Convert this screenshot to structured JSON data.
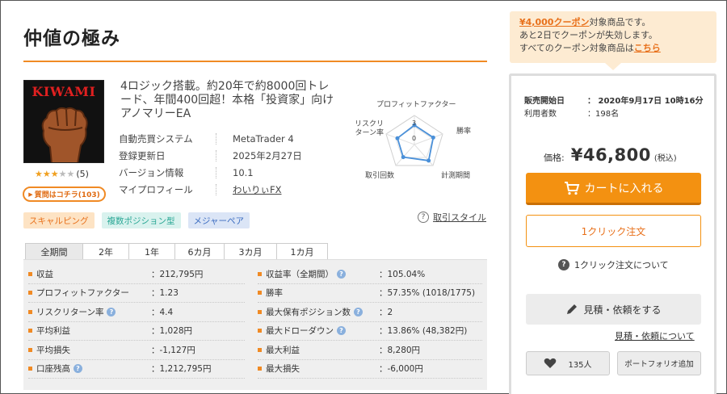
{
  "page": {
    "title": "仲値の極み"
  },
  "product": {
    "logo_text": "KIWAMI",
    "description": "4ロジック搭載。約20年で約8000回トレード、年間400回超！本格「投資家」向けアノマリーEA",
    "rating": 3,
    "rating_max": 5,
    "review_count": "(5)",
    "question_button": "質問はコチラ(103)",
    "info": [
      {
        "label": "自動売買システム",
        "value": "MetaTrader 4"
      },
      {
        "label": "登録更新日",
        "value": "2025年2月27日"
      },
      {
        "label": "バージョン情報",
        "value": "10.1"
      },
      {
        "label": "マイプロフィール",
        "value": "わいりぃFX"
      }
    ],
    "tags": [
      "スキャルピング",
      "複数ポジション型",
      "メジャーペア"
    ],
    "trade_style_link": "取引スタイル"
  },
  "radar": {
    "labels": {
      "profit_factor": "プロフィットファクター",
      "win_rate": "勝率",
      "period": "計測期間",
      "trades": "取引回数",
      "risk_return": "リスクリターン率"
    },
    "scale_max": "3",
    "scale_zero": "0",
    "values": [
      2,
      2,
      2.3,
      1.8,
      1.8
    ]
  },
  "period_tabs": [
    "全期間",
    "2年",
    "1年",
    "6カ月",
    "3カ月",
    "1カ月"
  ],
  "active_tab": "全期間",
  "stats_left": [
    {
      "label": "収益",
      "value": "：212,795円",
      "info": false
    },
    {
      "label": "プロフィットファクター",
      "value": "：1.23",
      "info": false
    },
    {
      "label": "リスクリターン率",
      "value": "：4.4",
      "info": true
    },
    {
      "label": "平均利益",
      "value": "：1,028円",
      "info": false
    },
    {
      "label": "平均損失",
      "value": "：-1,127円",
      "info": false
    },
    {
      "label": "口座残高",
      "value": "：1,212,795円",
      "info": true
    }
  ],
  "stats_right": [
    {
      "label": "収益率（全期間）",
      "value": "：105.04%",
      "info": true
    },
    {
      "label": "勝率",
      "value": "：57.35% (1018/1775)",
      "info": false
    },
    {
      "label": "最大保有ポジション数",
      "value": "：2",
      "info": true
    },
    {
      "label": "最大ドローダウン",
      "value": "：13.86% (48,382円)",
      "info": true
    },
    {
      "label": "最大利益",
      "value": "：8,280円",
      "info": false
    },
    {
      "label": "最大損失",
      "value": "：-6,000円",
      "info": false
    }
  ],
  "coupon": {
    "highlight": "¥4,000クーポン",
    "line1_rest": "対象商品です。",
    "line2": "あと2日でクーポンが失効します。",
    "line3_prefix": "すべてのクーポン対象商品は",
    "line3_link": "こちら"
  },
  "buybox": {
    "sale_start_label": "販売開始日",
    "sale_start_value": "：  2020年9月17日 10時16分",
    "users_label": "利用者数",
    "users_value": "：198名",
    "price_label": "価格:",
    "price_value": "¥46,800",
    "price_tax": "(税込)",
    "cart_button": "カートに入れる",
    "oneclick_button": "1クリック注文",
    "oneclick_info": "1クリック注文について",
    "quote_button": "見積・依頼をする",
    "quote_link": "見積・依頼について",
    "favorite_count": "135人",
    "portfolio_button": "ポートフォリオ追加"
  },
  "colors": {
    "accent": "#f39111",
    "tag_orange": "#e8701a",
    "tag_teal": "#2aa795",
    "tag_blue": "#3b6cc0"
  }
}
